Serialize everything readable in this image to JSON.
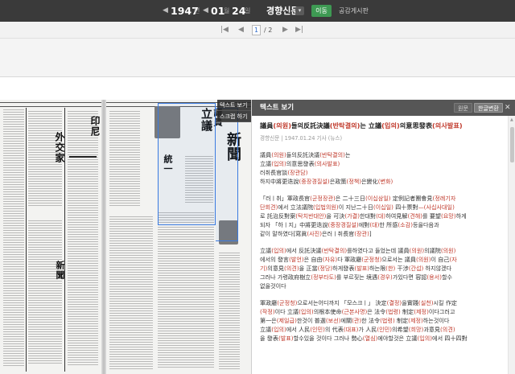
{
  "date_nav": {
    "prev_year": "◀",
    "year": "1947",
    "year_unit": "년",
    "prev_month": "◀",
    "month": "01",
    "month_unit": "월",
    "prev_day": "◀",
    "day": "24",
    "day_unit": "일",
    "newspaper": "경향신문",
    "caret": "▾",
    "go_label": "이동",
    "share_label": "공감게시판"
  },
  "pagination": {
    "first": "|◀",
    "prev": "◀",
    "current_page": "1",
    "total": "/ 2",
    "next": "▶",
    "last": "▶|"
  },
  "scan_menu": {
    "items": [
      "텍스트 보기",
      "스크랩 하기"
    ]
  },
  "text_panel": {
    "title": "텍스트 보기",
    "tab_original": "원문",
    "tab_korean": "한글변환",
    "close": "✕",
    "article_title": [
      {
        "t": "議員"
      },
      {
        "t": "(의원)",
        "g": true
      },
      {
        "t": "들의反託決議"
      },
      {
        "t": "(반탁결의)",
        "g": true
      },
      {
        "t": "는 立議"
      },
      {
        "t": "(입의)",
        "g": true
      },
      {
        "t": "의意思發表"
      },
      {
        "t": "(의사발표)",
        "g": true
      }
    ],
    "meta": "경향신문 | 1947.01.24 기사 (뉴스)",
    "paragraphs": [
      [
        [
          {
            "t": "議員"
          },
          {
            "t": "(의원)",
            "g": true
          },
          {
            "t": "들의反託決議"
          },
          {
            "t": "(반탁결의)",
            "g": true
          },
          {
            "t": "는"
          }
        ],
        [
          {
            "t": "立議"
          },
          {
            "t": "(입의)",
            "g": true
          },
          {
            "t": "의意思發表"
          },
          {
            "t": "(의사발표)",
            "g": true
          }
        ],
        [
          {
            "t": "러취長官談"
          },
          {
            "t": "(장관담)",
            "g": true
          }
        ],
        [
          {
            "t": "하지中將更迭說"
          },
          {
            "t": "(중장경질설)",
            "g": true
          },
          {
            "t": "은政策"
          },
          {
            "t": "(정책)",
            "g": true
          },
          {
            "t": "은變化"
          },
          {
            "t": "(변화)",
            "g": true
          }
        ]
      ],
      [
        [
          {
            "t": "「러ㅣ취」軍政長官"
          },
          {
            "t": "(군정장관)",
            "g": true
          },
          {
            "t": "은 二十三日"
          },
          {
            "t": "(이십삼일)",
            "g": true
          },
          {
            "t": " 定例記者團會見"
          },
          {
            "t": "(정례기자",
            "g": true
          }
        ],
        [
          {
            "t": "단회견)",
            "g": true
          },
          {
            "t": "에서 立法議院"
          },
          {
            "t": "(입법의원)",
            "g": true
          },
          {
            "t": "이 지난二十日"
          },
          {
            "t": "(이십일)",
            "g": true
          },
          {
            "t": " 四十票對"
          },
          {
            "t": "—(사십사대일)",
            "g": true
          }
        ],
        [
          {
            "t": "로 託治反對案"
          },
          {
            "t": "(탁치반대안)",
            "g": true
          },
          {
            "t": "을 可決"
          },
          {
            "t": "(가결)",
            "g": true
          },
          {
            "t": "한대對"
          },
          {
            "t": "(대)",
            "g": true
          },
          {
            "t": "하여見解"
          },
          {
            "t": "(견해)",
            "g": true
          },
          {
            "t": "를 要望"
          },
          {
            "t": "(요망)",
            "g": true
          },
          {
            "t": "하게"
          }
        ],
        [
          {
            "t": "되자 「하ㅣ지」中將更迭說"
          },
          {
            "t": "(중장경질설)",
            "g": true
          },
          {
            "t": "에對"
          },
          {
            "t": "(대)",
            "g": true
          },
          {
            "t": "한 所感"
          },
          {
            "t": "(소감)",
            "g": true
          },
          {
            "t": "등을다음과"
          }
        ],
        [
          {
            "t": "같이 말하였다[寫眞"
          },
          {
            "t": "(사진)",
            "g": true
          },
          {
            "t": "은러ㅣ취長官"
          },
          {
            "t": "(장관)",
            "g": true
          },
          {
            "t": "]"
          }
        ]
      ],
      [
        [
          {
            "t": "立議"
          },
          {
            "t": "(입의)",
            "g": true
          },
          {
            "t": "에서 反託決議"
          },
          {
            "t": "(반탁결의)",
            "g": true
          },
          {
            "t": "를하였다고 들었는데 議員"
          },
          {
            "t": "(의원)",
            "g": true
          },
          {
            "t": "의議院"
          },
          {
            "t": "(의원)",
            "g": true
          }
        ],
        [
          {
            "t": "에서의 發言"
          },
          {
            "t": "(발언)",
            "g": true
          },
          {
            "t": "은 自由"
          },
          {
            "t": "(자유)",
            "g": true
          },
          {
            "t": "다 軍政廳"
          },
          {
            "t": "(군정청)",
            "g": true
          },
          {
            "t": "으로서는 議員"
          },
          {
            "t": "(의원)",
            "g": true
          },
          {
            "t": "이 自己"
          },
          {
            "t": "(자",
            "g": true
          }
        ],
        [
          {
            "t": "기)",
            "g": true
          },
          {
            "t": "의意見"
          },
          {
            "t": "(의견)",
            "g": true
          },
          {
            "t": "을 正當"
          },
          {
            "t": "(정당)",
            "g": true
          },
          {
            "t": "하게發表"
          },
          {
            "t": "(발표)",
            "g": true
          },
          {
            "t": "하는限"
          },
          {
            "t": "(한)",
            "g": true
          },
          {
            "t": " 干涉"
          },
          {
            "t": "(간섭)",
            "g": true
          },
          {
            "t": " 하지않겠다"
          }
        ],
        [
          {
            "t": "그러나 가령政府樹立"
          },
          {
            "t": "(정부타도)",
            "g": true
          },
          {
            "t": "를 부르짖는 境遇"
          },
          {
            "t": "(경우)",
            "g": true
          },
          {
            "t": "가있다면 容認"
          },
          {
            "t": "(용서)",
            "g": true
          },
          {
            "t": "할수"
          }
        ],
        [
          {
            "t": "없을것이다"
          }
        ]
      ],
      [
        [
          {
            "t": "軍政廳"
          },
          {
            "t": "(군정청)",
            "g": true
          },
          {
            "t": "으로서는어디까지 「모스크ㅣ」 決定"
          },
          {
            "t": "(결정)",
            "g": true
          },
          {
            "t": "을實踐"
          },
          {
            "t": "(실천)",
            "g": true
          },
          {
            "t": "시킬 作定"
          }
        ],
        [
          {
            "t": "(작정)",
            "g": true
          },
          {
            "t": "이다 立議"
          },
          {
            "t": "(입의)",
            "g": true
          },
          {
            "t": "의根本使命"
          },
          {
            "t": "(근본사명)",
            "g": true
          },
          {
            "t": "은 法令"
          },
          {
            "t": "(법령)",
            "g": true
          },
          {
            "t": " 制定"
          },
          {
            "t": "(제정)",
            "g": true
          },
          {
            "t": "이다그러고"
          }
        ],
        [
          {
            "t": "第一은"
          },
          {
            "t": "(제일급)",
            "g": true
          },
          {
            "t": "한것이 普選"
          },
          {
            "t": "(보선)",
            "g": true
          },
          {
            "t": "에關"
          },
          {
            "t": "(관)",
            "g": true
          },
          {
            "t": "한 法令"
          },
          {
            "t": "(법령)",
            "g": true
          },
          {
            "t": " 制定"
          },
          {
            "t": "(제정)",
            "g": true
          },
          {
            "t": "하는것이다"
          }
        ],
        [
          {
            "t": "立議"
          },
          {
            "t": "(입의)",
            "g": true
          },
          {
            "t": "에서 人民"
          },
          {
            "t": "(인민)",
            "g": true
          },
          {
            "t": "의 代表"
          },
          {
            "t": "(대표)",
            "g": true
          },
          {
            "t": "가 人民"
          },
          {
            "t": "(인민)",
            "g": true
          },
          {
            "t": "의希望"
          },
          {
            "t": "(희망)",
            "g": true
          },
          {
            "t": "과意見"
          },
          {
            "t": "(의견)",
            "g": true
          }
        ],
        [
          {
            "t": "을 發表"
          },
          {
            "t": "(발표)",
            "g": true
          },
          {
            "t": "할수있을 것이다 그러나 勢心"
          },
          {
            "t": "(열심)",
            "g": true
          },
          {
            "t": "에야할것은 立議"
          },
          {
            "t": "(입의)",
            "g": true
          },
          {
            "t": "에서 四十四對"
          }
        ]
      ]
    ]
  }
}
